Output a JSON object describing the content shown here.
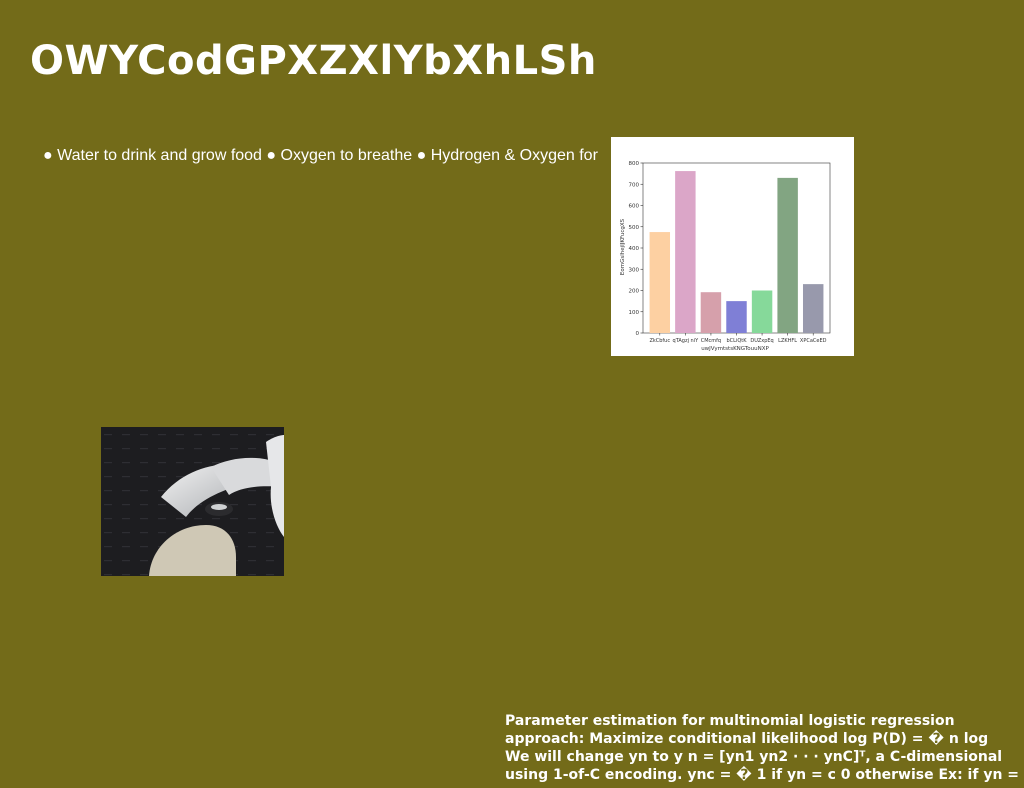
{
  "slide": {
    "title": "OWYCodGPXZXlYbXhLSh",
    "bullets_text": "● Water to drink and grow food ● Oxygen to breathe ● Hydrogen & Oxygen for",
    "footnote_lines": [
      "Parameter estimation for multinomial logistic regression",
      "approach: Maximize conditional likelihood log P(D) = � n log",
      "We will change yn to y n = [yn1 yn2 · · · ynC]ᵀ, a C-dimensional",
      "using 1-of-C encoding. ync = � 1 if yn = c 0 otherwise Ex: if yn ="
    ]
  },
  "chart_data": {
    "type": "bar",
    "categories": [
      "ZkCbfuc",
      "qTAgzj niY",
      "CMcmfq",
      "bCLiQtK",
      "DUZxpEq",
      "LZKHFL",
      "XPCaCeED"
    ],
    "values": [
      475,
      762,
      192,
      150,
      200,
      730,
      230
    ],
    "colors": [
      "#fdd0a2",
      "#dba6c8",
      "#d6a0ab",
      "#7f7fd6",
      "#86d99a",
      "#82a582",
      "#9899ac"
    ],
    "xlabel": "uwJVymtstsKNGTouuNXP",
    "ylabel": "EomGslhejIJKFucgXS",
    "ylim": [
      0,
      800
    ],
    "yticks": [
      0,
      100,
      200,
      300,
      400,
      500,
      600,
      700,
      800
    ],
    "grid": false
  }
}
